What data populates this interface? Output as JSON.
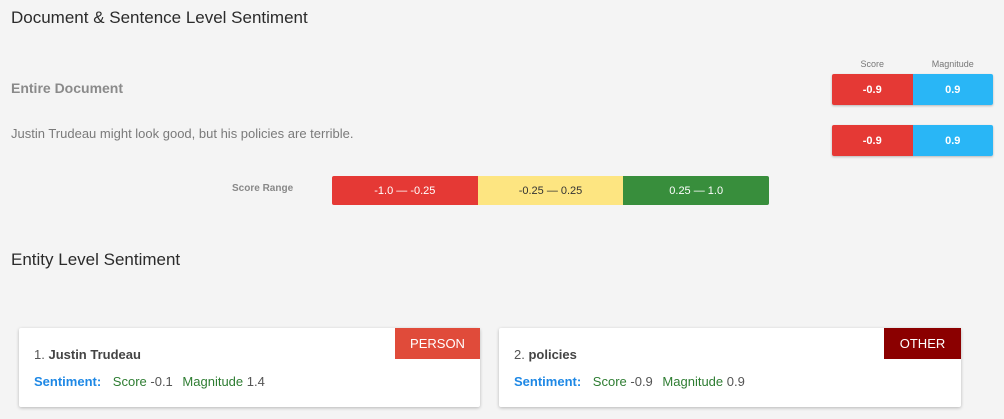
{
  "doc_section": {
    "title": "Document & Sentence Level Sentiment",
    "col_score": "Score",
    "col_magnitude": "Magnitude",
    "rows": [
      {
        "label": "Entire Document",
        "score": "-0.9",
        "magnitude": "0.9"
      },
      {
        "label": "Justin Trudeau might look good, but his policies are terrible.",
        "score": "-0.9",
        "magnitude": "0.9"
      }
    ],
    "score_range_label": "Score Range",
    "ranges": [
      "-1.0 — -0.25",
      "-0.25 — 0.25",
      "0.25 — 1.0"
    ]
  },
  "entity_section": {
    "title": "Entity Level Sentiment",
    "sentiment_label": "Sentiment:",
    "score_key": "Score",
    "magnitude_key": "Magnitude",
    "entities": [
      {
        "index": "1.",
        "name": "Justin Trudeau",
        "type": "PERSON",
        "score": "-0.1",
        "magnitude": "1.4"
      },
      {
        "index": "2.",
        "name": "policies",
        "type": "OTHER",
        "score": "-0.9",
        "magnitude": "0.9"
      }
    ]
  },
  "colors": {
    "negative": "#e53935",
    "neutral": "#fde581",
    "positive": "#388e3c",
    "magnitude": "#29b6f6",
    "person_badge": "#e04b3a",
    "other_badge": "#8b0000"
  }
}
